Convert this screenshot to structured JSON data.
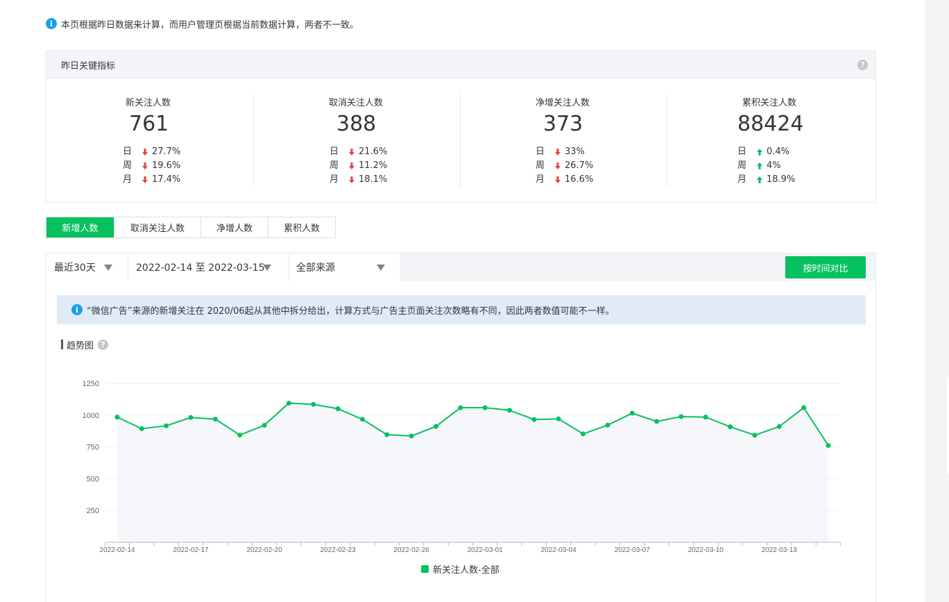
{
  "notice": {
    "text": "本页根据昨日数据来计算，而用户管理页根据当前数据计算，两者不一致。"
  },
  "kpi": {
    "title": "昨日关键指标",
    "metrics": [
      {
        "label": "新关注人数",
        "value": "761",
        "rows": [
          {
            "period": "日",
            "dir": "down",
            "pct": "27.7%"
          },
          {
            "period": "周",
            "dir": "down",
            "pct": "19.6%"
          },
          {
            "period": "月",
            "dir": "down",
            "pct": "17.4%"
          }
        ]
      },
      {
        "label": "取消关注人数",
        "value": "388",
        "rows": [
          {
            "period": "日",
            "dir": "down",
            "pct": "21.6%"
          },
          {
            "period": "周",
            "dir": "down",
            "pct": "11.2%"
          },
          {
            "period": "月",
            "dir": "down",
            "pct": "18.1%"
          }
        ]
      },
      {
        "label": "净增关注人数",
        "value": "373",
        "rows": [
          {
            "period": "日",
            "dir": "down",
            "pct": "33%"
          },
          {
            "period": "周",
            "dir": "down",
            "pct": "26.7%"
          },
          {
            "period": "月",
            "dir": "down",
            "pct": "16.6%"
          }
        ]
      },
      {
        "label": "累积关注人数",
        "value": "88424",
        "rows": [
          {
            "period": "日",
            "dir": "up",
            "pct": "0.4%"
          },
          {
            "period": "周",
            "dir": "up",
            "pct": "4%"
          },
          {
            "period": "月",
            "dir": "up",
            "pct": "18.9%"
          }
        ]
      }
    ]
  },
  "tabs": [
    {
      "label": "新增人数",
      "active": true
    },
    {
      "label": "取消关注人数",
      "active": false
    },
    {
      "label": "净增人数",
      "active": false
    },
    {
      "label": "累积人数",
      "active": false
    }
  ],
  "filters": {
    "range": "最近30天",
    "dates": "2022-02-14 至 2022-03-15",
    "source": "全部来源",
    "compare_label": "按时间对比"
  },
  "source_notice": "“微信广告”来源的新增关注在 2020/06起从其他中拆分给出，计算方式与广告主页面关注次数略有不同，因此两者数值可能不一样。",
  "trend_title": "趋势图",
  "colors": {
    "accent": "#07c160",
    "down": "#e64340",
    "up": "#07c160",
    "info": "#1aa0e8"
  },
  "chart_data": {
    "type": "area",
    "x": [
      "2022-02-14",
      "2022-02-15",
      "2022-02-16",
      "2022-02-17",
      "2022-02-18",
      "2022-02-19",
      "2022-02-20",
      "2022-02-21",
      "2022-02-22",
      "2022-02-23",
      "2022-02-24",
      "2022-02-25",
      "2022-02-26",
      "2022-02-27",
      "2022-02-28",
      "2022-03-01",
      "2022-03-02",
      "2022-03-03",
      "2022-03-04",
      "2022-03-05",
      "2022-03-06",
      "2022-03-07",
      "2022-03-08",
      "2022-03-09",
      "2022-03-10",
      "2022-03-11",
      "2022-03-12",
      "2022-03-13",
      "2022-03-14",
      "2022-03-15"
    ],
    "x_tick_labels": [
      "2022-02-14",
      "2022-02-17",
      "2022-02-20",
      "2022-02-23",
      "2022-02-26",
      "2022-03-01",
      "2022-03-04",
      "2022-03-07",
      "2022-03-10",
      "2022-03-13"
    ],
    "series": [
      {
        "name": "新关注人数-全部",
        "values": [
          984,
          893,
          916,
          981,
          968,
          843,
          920,
          1094,
          1084,
          1050,
          967,
          846,
          836,
          911,
          1058,
          1058,
          1038,
          965,
          970,
          852,
          921,
          1015,
          950,
          988,
          984,
          908,
          842,
          910,
          1058,
          761
        ]
      }
    ],
    "yticks": [
      250,
      500,
      750,
      1000,
      1250
    ],
    "ylim": [
      0,
      1250
    ],
    "grid": true,
    "legend": "bottom-center"
  }
}
